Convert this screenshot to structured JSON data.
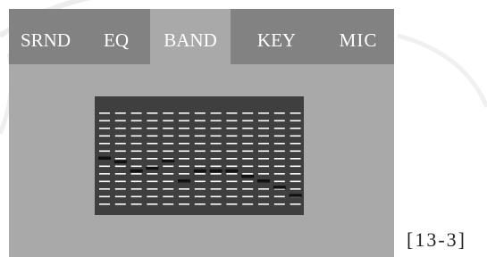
{
  "tabs": [
    {
      "label": "SRND",
      "active": false
    },
    {
      "label": "EQ",
      "active": false
    },
    {
      "label": "BAND",
      "active": true
    },
    {
      "label": "KEY",
      "active": false
    },
    {
      "label": "MIC",
      "active": false
    }
  ],
  "equalizer": {
    "bands": 13,
    "segments_per_band": 13,
    "levels": [
      0.5,
      0.46,
      0.36,
      0.39,
      0.47,
      0.25,
      0.36,
      0.36,
      0.36,
      0.3,
      0.25,
      0.18,
      0.09
    ]
  },
  "caption": "[13-3]",
  "colors": {
    "tab_bar": "#828282",
    "active_tab": "#a9a9a9",
    "screen_bg": "#a9a9a9",
    "eq_panel": "#3f3f3f",
    "segment": "#ffffff",
    "tab_text": "#ffffff"
  }
}
